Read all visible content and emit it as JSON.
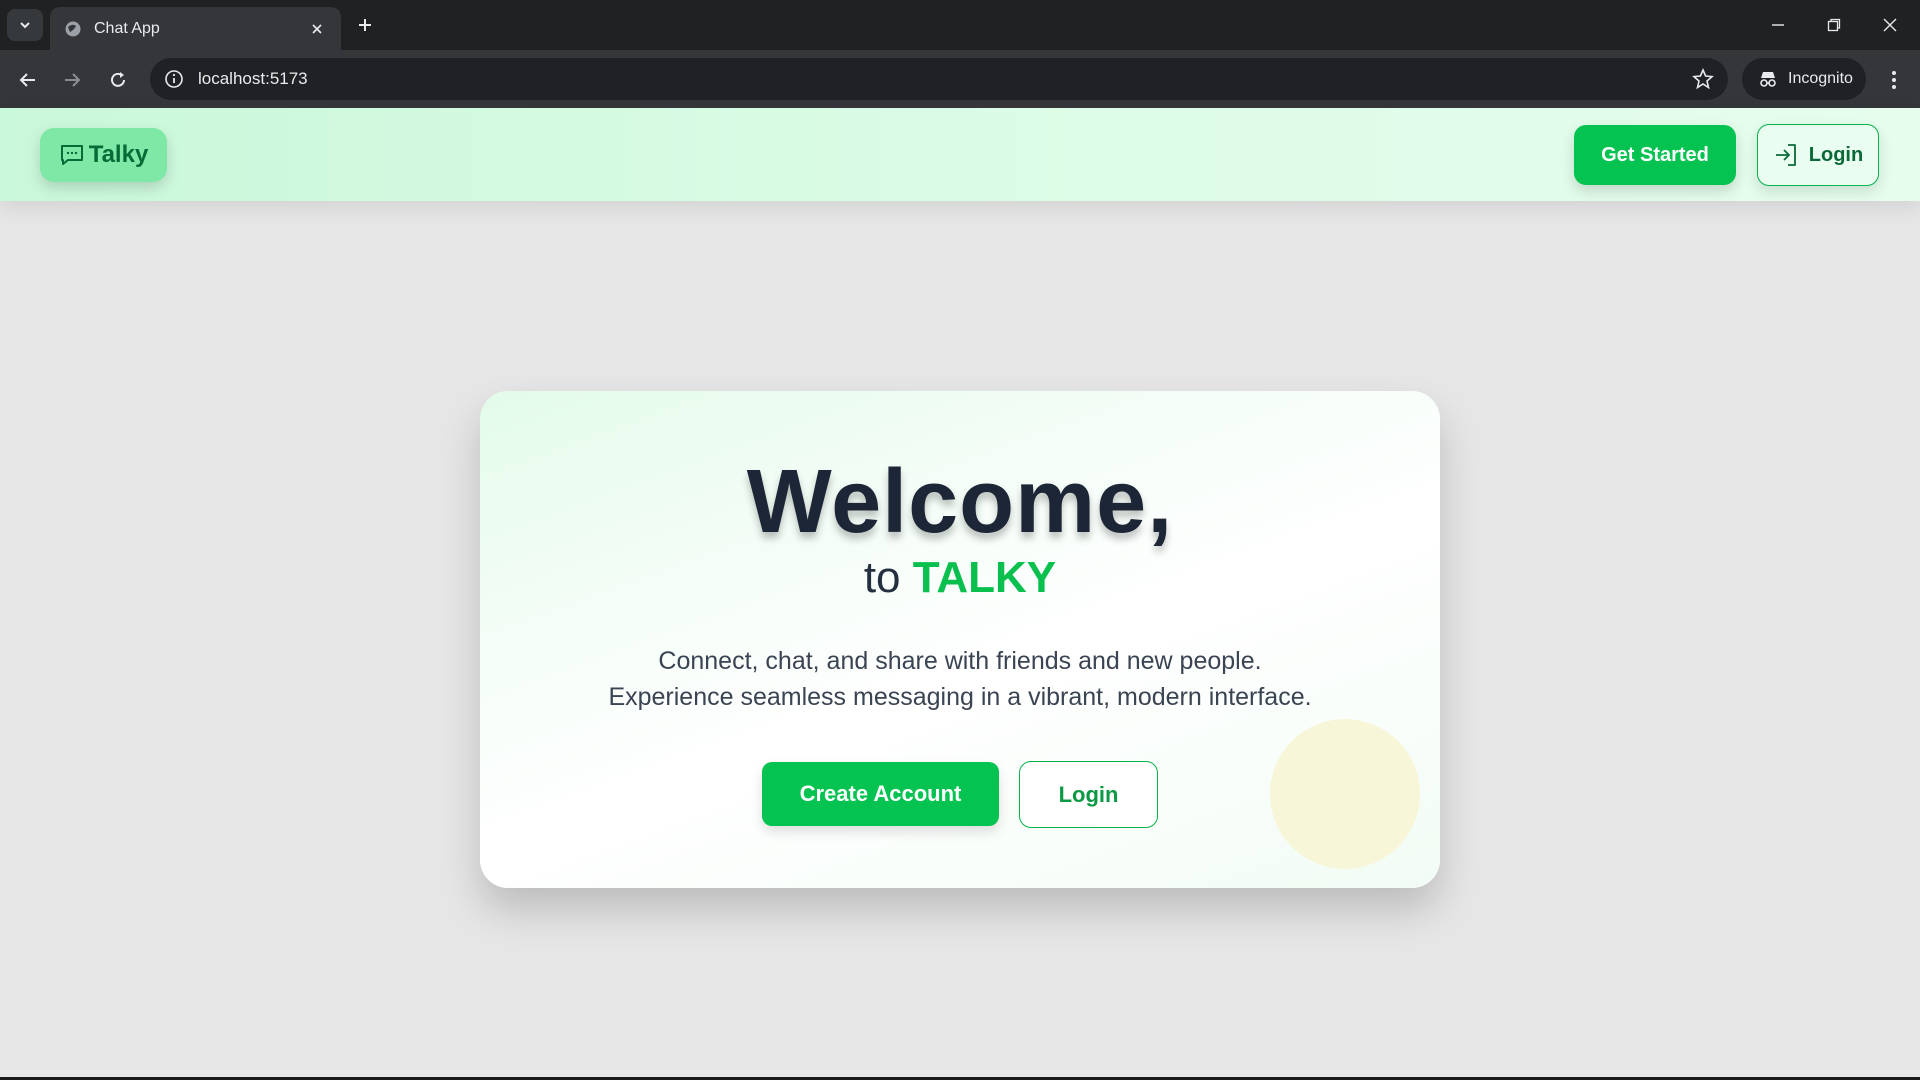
{
  "browser": {
    "tab_title": "Chat App",
    "url": "localhost:5173",
    "incognito_label": "Incognito"
  },
  "header": {
    "brand": "Talky",
    "get_started": "Get Started",
    "login": "Login"
  },
  "hero": {
    "title": "Welcome,",
    "sub_prefix": "to",
    "sub_accent": "TALKY",
    "desc_line1": "Connect, chat, and share with friends and new people.",
    "desc_line2": "Experience seamless messaging in a vibrant, modern interface.",
    "create_account": "Create Account",
    "login": "Login"
  },
  "colors": {
    "accent": "#05c350",
    "dark_text": "#1d2636"
  }
}
